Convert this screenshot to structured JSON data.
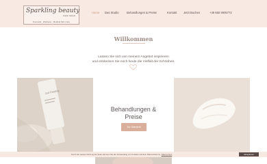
{
  "logo": {
    "script": "Sparkling beauty",
    "sub": "Katrin Schulz",
    "tagline": "Kosmetik · Wellness · Medical Skin Care"
  },
  "nav": {
    "items": [
      {
        "label": "Home",
        "active": true
      },
      {
        "label": "Das Studio",
        "active": false
      },
      {
        "label": "Behandlungen & Preise",
        "active": false
      },
      {
        "label": "Kontakt",
        "active": false
      },
      {
        "label": "Jetzt Buchen",
        "active": false
      },
      {
        "label": "+49 650 9905772",
        "active": false
      }
    ],
    "active_color": "#d29b86"
  },
  "main": {
    "title": "Willkommen",
    "intro_line1": "Lassen Sie sich von meinem Angebot inspirieren",
    "intro_line2": "und entdecken Sie noch heute die Vielfalt der Schönheit.",
    "feature_title_line1": "Behandlungen &",
    "feature_title_line2": "Preise",
    "feature_button": "Zur Übersicht",
    "tube_label": "Gel Peeling"
  },
  "cookie": {
    "text": "Durch die weitere Nutzung der Seite stimmen Sie der Verwendung von Cookies und dem Datenschutz zu.",
    "link": "Datenschutz",
    "accept": "Akzeptieren"
  },
  "colors": {
    "header_bg": "#f8e9e2",
    "accent": "#d9af9b",
    "dark_button": "#5b4b48"
  }
}
